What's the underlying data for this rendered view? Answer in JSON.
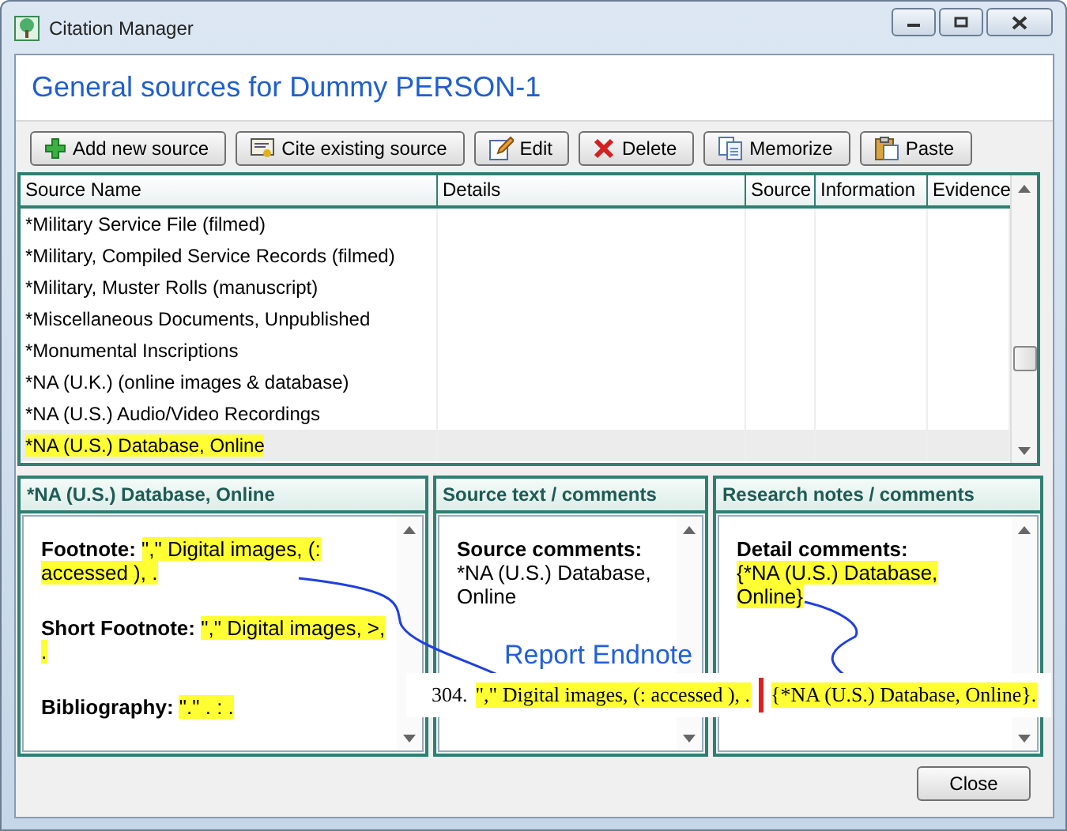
{
  "window": {
    "title": "Citation Manager"
  },
  "header": {
    "title": "General sources for Dummy PERSON-1"
  },
  "toolbar": [
    {
      "kind": "add",
      "label": "Add new source"
    },
    {
      "kind": "cite",
      "label": "Cite existing source"
    },
    {
      "kind": "edit",
      "label": "Edit"
    },
    {
      "kind": "delete",
      "label": "Delete"
    },
    {
      "kind": "memorize",
      "label": "Memorize"
    },
    {
      "kind": "paste",
      "label": "Paste"
    }
  ],
  "table": {
    "columns": [
      "Source Name",
      "Details",
      "Source",
      "Information",
      "Evidence"
    ],
    "rows": [
      {
        "source_name": "*Military Service File (filmed)",
        "selected": false
      },
      {
        "source_name": "*Military, Compiled Service Records (filmed)",
        "selected": false
      },
      {
        "source_name": "*Military, Muster Rolls (manuscript)",
        "selected": false
      },
      {
        "source_name": "*Miscellaneous Documents, Unpublished",
        "selected": false
      },
      {
        "source_name": "*Monumental Inscriptions",
        "selected": false
      },
      {
        "source_name": "*NA (U.K.) (online images & database)",
        "selected": false
      },
      {
        "source_name": "*NA (U.S.) Audio/Video Recordings",
        "selected": false
      },
      {
        "source_name": "*NA (U.S.) Database, Online",
        "selected": true
      }
    ]
  },
  "panels": [
    {
      "title": "*NA (U.S.) Database, Online",
      "fields": [
        {
          "kind": "inline",
          "label": "Footnote:",
          "value": "\",\" Digital images, (: accessed ), .",
          "highlighted": true
        },
        {
          "kind": "inline",
          "label": "Short Footnote:",
          "value": "\",\" Digital images, >, .",
          "highlighted": true
        },
        {
          "kind": "inline",
          "label": "Bibliography:",
          "value": "\".\" . : .",
          "highlighted": true
        }
      ]
    },
    {
      "title": "Source text / comments",
      "fields": [
        {
          "kind": "stacked",
          "label": "Source comments:",
          "value": "*NA (U.S.) Database, Online",
          "highlighted": false
        }
      ]
    },
    {
      "title": "Research notes / comments",
      "fields": [
        {
          "kind": "stacked",
          "label": "Detail comments:",
          "value": "{*NA (U.S.) Database, Online}",
          "highlighted": true
        }
      ]
    }
  ],
  "annotation": {
    "label": "Report Endnote",
    "number": "304.",
    "footnote": "\",\" Digital images,  (: accessed ), .",
    "comment": "{*NA (U.S.) Database, Online}."
  },
  "buttons": [
    {
      "label": "Close"
    }
  ]
}
